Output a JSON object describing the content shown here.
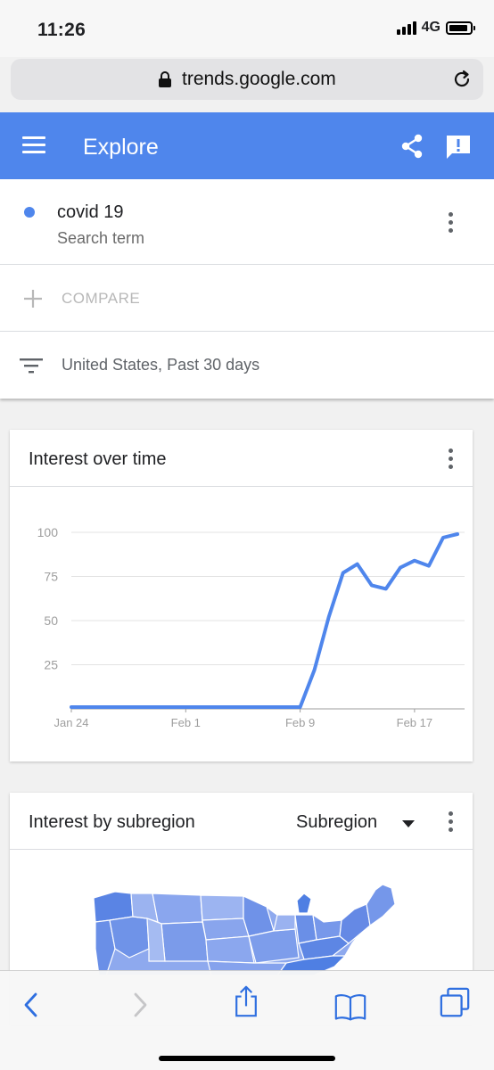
{
  "status": {
    "time": "11:26",
    "network": "4G",
    "battery_level": 0.9
  },
  "browser": {
    "url": "trends.google.com"
  },
  "app_bar": {
    "title": "Explore"
  },
  "search": {
    "term": "covid 19",
    "term_type": "Search term",
    "compare_label": "COMPARE",
    "filter_label": "United States, Past 30 days",
    "series_color": "#4f86ec"
  },
  "interest_over_time": {
    "title": "Interest over time",
    "chart_data": {
      "type": "line",
      "x_tick_labels": [
        "Jan 24",
        "Feb 1",
        "Feb 9",
        "Feb 17"
      ],
      "y_tick_labels": [
        "100",
        "75",
        "50",
        "25"
      ],
      "ylim": [
        0,
        100
      ],
      "grid": true,
      "series": [
        {
          "color": "#4f86ec",
          "values": [
            1,
            1,
            1,
            1,
            1,
            1,
            1,
            1,
            1,
            1,
            1,
            1,
            1,
            1,
            1,
            1,
            1,
            22,
            52,
            77,
            82,
            70,
            68,
            80,
            84,
            81,
            97,
            99
          ]
        }
      ]
    }
  },
  "interest_by_subregion": {
    "title": "Interest by subregion",
    "dropdown_label": "Subregion"
  }
}
